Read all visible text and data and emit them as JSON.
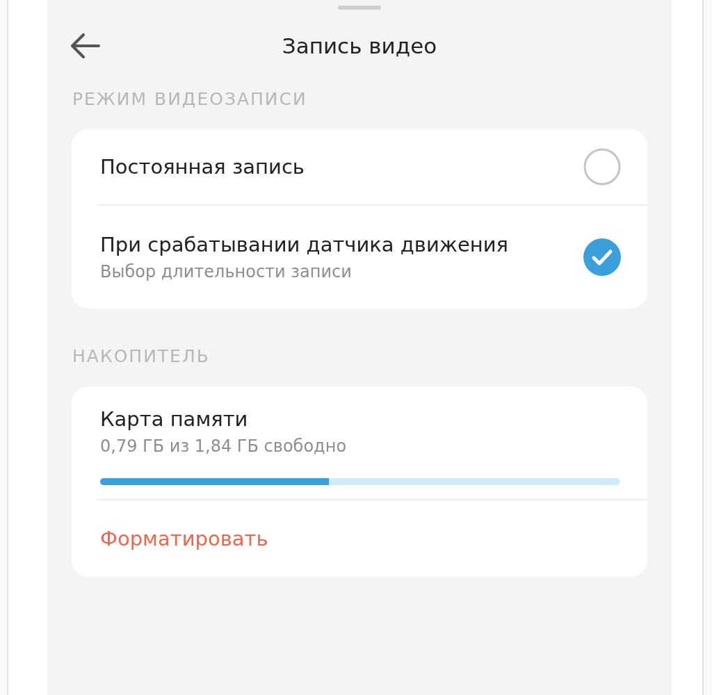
{
  "header": {
    "title": "Запись видео"
  },
  "sections": [
    {
      "title": "РЕЖИМ ВИДЕОЗАПИСИ",
      "items": [
        {
          "kind": "radio",
          "label": "Постоянная запись",
          "selected": false
        },
        {
          "kind": "radio",
          "label": "При срабатывании датчика движения",
          "subtitle": "Выбор длительности записи",
          "selected": true
        }
      ]
    },
    {
      "title": "НАКОПИТЕЛЬ",
      "items": [
        {
          "kind": "storage",
          "label": "Карта памяти",
          "subtitle": "0,79 ГБ из 1,84 ГБ свободно",
          "level": 0.44
        },
        {
          "kind": "action",
          "label": "Форматировать"
        }
      ]
    }
  ]
}
